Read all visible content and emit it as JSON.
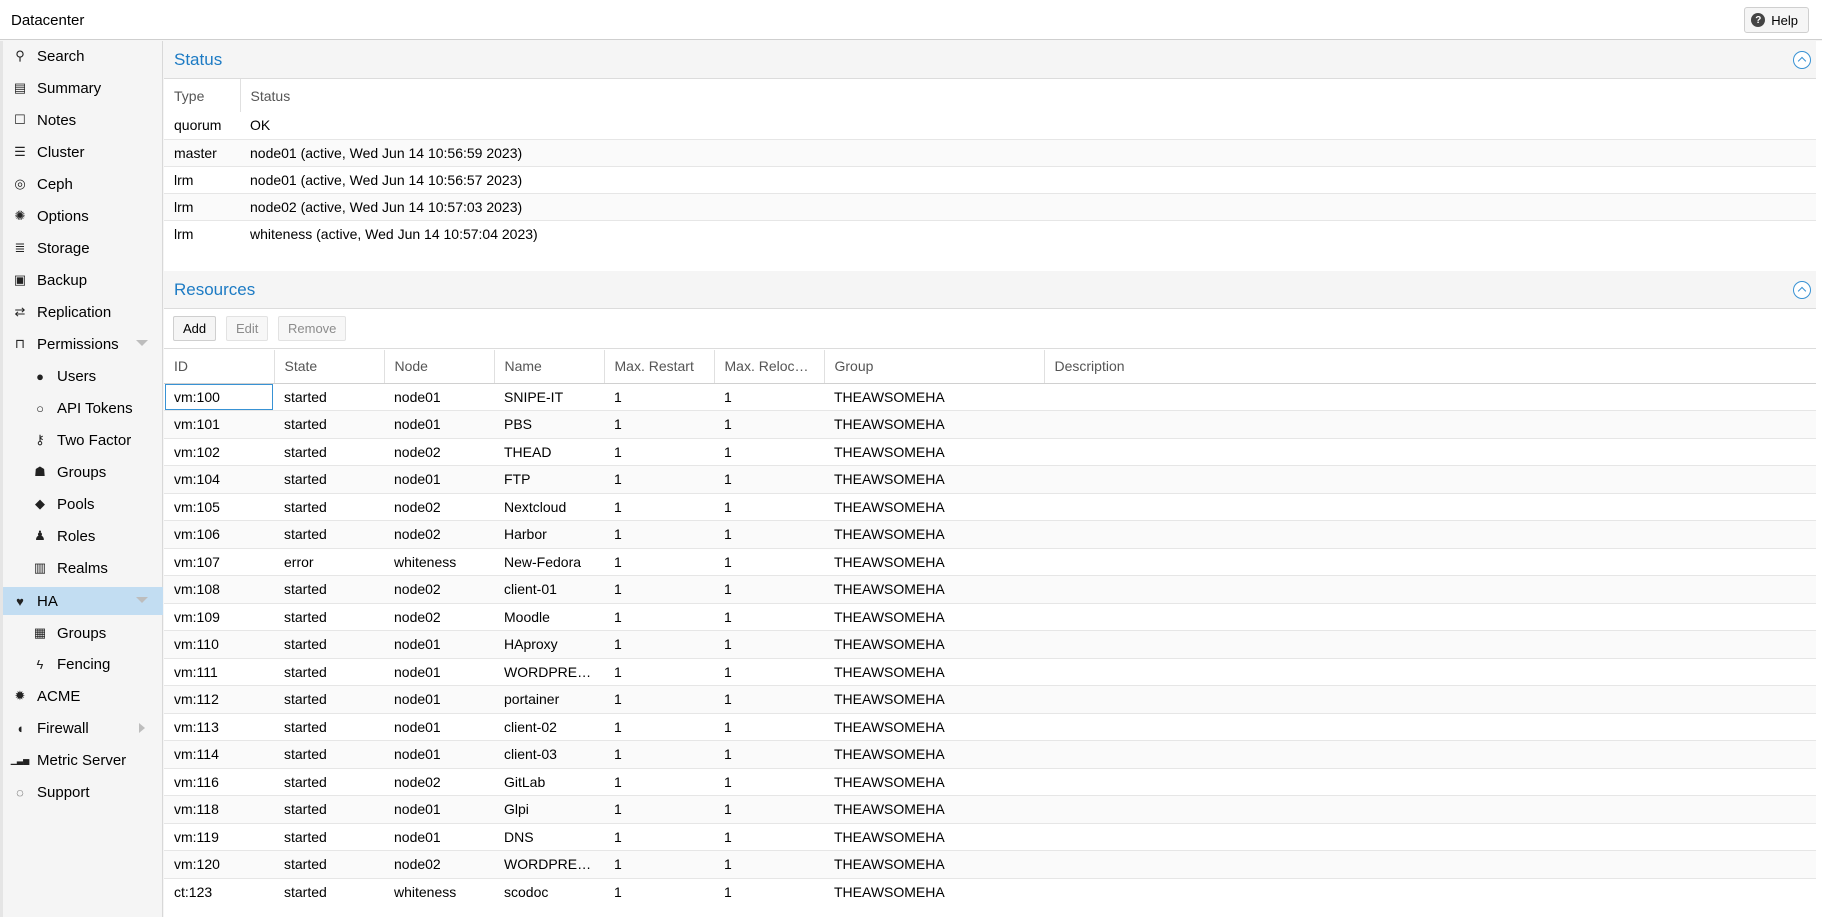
{
  "header": {
    "title": "Datacenter",
    "help_label": "Help"
  },
  "sidebar": {
    "items": [
      {
        "label": "Search",
        "icon": "search-icon",
        "glyph": "⚲",
        "sub": false
      },
      {
        "label": "Summary",
        "icon": "book-icon",
        "glyph": "▤",
        "sub": false
      },
      {
        "label": "Notes",
        "icon": "note-icon",
        "glyph": "☐",
        "sub": false
      },
      {
        "label": "Cluster",
        "icon": "server-icon",
        "glyph": "☰",
        "sub": false
      },
      {
        "label": "Ceph",
        "icon": "ceph-icon",
        "glyph": "◎",
        "sub": false
      },
      {
        "label": "Options",
        "icon": "gear-icon",
        "glyph": "✺",
        "sub": false
      },
      {
        "label": "Storage",
        "icon": "database-icon",
        "glyph": "≣",
        "sub": false
      },
      {
        "label": "Backup",
        "icon": "floppy-icon",
        "glyph": "▣",
        "sub": false
      },
      {
        "label": "Replication",
        "icon": "retweet-icon",
        "glyph": "⇄",
        "sub": false
      },
      {
        "label": "Permissions",
        "icon": "unlock-icon",
        "glyph": "⊓",
        "sub": false,
        "expander": "down"
      },
      {
        "label": "Users",
        "icon": "user-icon",
        "glyph": "●",
        "sub": true
      },
      {
        "label": "API Tokens",
        "icon": "user-outline-icon",
        "glyph": "○",
        "sub": true
      },
      {
        "label": "Two Factor",
        "icon": "key-icon",
        "glyph": "⚷",
        "sub": true
      },
      {
        "label": "Groups",
        "icon": "users-icon",
        "glyph": "☗",
        "sub": true
      },
      {
        "label": "Pools",
        "icon": "tags-icon",
        "glyph": "◆",
        "sub": true
      },
      {
        "label": "Roles",
        "icon": "male-icon",
        "glyph": "♟",
        "sub": true
      },
      {
        "label": "Realms",
        "icon": "address-book-icon",
        "glyph": "▥",
        "sub": true
      },
      {
        "label": "HA",
        "icon": "heartbeat-icon",
        "glyph": "♥",
        "sub": false,
        "expander": "down",
        "selected": true
      },
      {
        "label": "Groups",
        "icon": "object-group-icon",
        "glyph": "▦",
        "sub": true
      },
      {
        "label": "Fencing",
        "icon": "bolt-icon",
        "glyph": "ϟ",
        "sub": true
      },
      {
        "label": "ACME",
        "icon": "certificate-icon",
        "glyph": "✹",
        "sub": false
      },
      {
        "label": "Firewall",
        "icon": "shield-icon",
        "glyph": "◖",
        "sub": false,
        "expander": "right"
      },
      {
        "label": "Metric Server",
        "icon": "bar-chart-icon",
        "glyph": "▁▃▅",
        "sub": false
      },
      {
        "label": "Support",
        "icon": "comments-icon",
        "glyph": "◌",
        "sub": false
      }
    ]
  },
  "status": {
    "title": "Status",
    "columns": [
      "Type",
      "Status"
    ],
    "rows": [
      [
        "quorum",
        "OK"
      ],
      [
        "master",
        "node01 (active, Wed Jun 14 10:56:59 2023)"
      ],
      [
        "lrm",
        "node01 (active, Wed Jun 14 10:56:57 2023)"
      ],
      [
        "lrm",
        "node02 (active, Wed Jun 14 10:57:03 2023)"
      ],
      [
        "lrm",
        "whiteness (active, Wed Jun 14 10:57:04 2023)"
      ]
    ]
  },
  "resources": {
    "title": "Resources",
    "toolbar": {
      "add": "Add",
      "edit": "Edit",
      "remove": "Remove"
    },
    "columns": [
      "ID",
      "State",
      "Node",
      "Name",
      "Max. Restart",
      "Max. Relocate",
      "Group",
      "Description"
    ],
    "rows": [
      [
        "vm:100",
        "started",
        "node01",
        "SNIPE-IT",
        "1",
        "1",
        "THEAWSOMEHA",
        ""
      ],
      [
        "vm:101",
        "started",
        "node01",
        "PBS",
        "1",
        "1",
        "THEAWSOMEHA",
        ""
      ],
      [
        "vm:102",
        "started",
        "node02",
        "THEAD",
        "1",
        "1",
        "THEAWSOMEHA",
        ""
      ],
      [
        "vm:104",
        "started",
        "node01",
        "FTP",
        "1",
        "1",
        "THEAWSOMEHA",
        ""
      ],
      [
        "vm:105",
        "started",
        "node02",
        "Nextcloud",
        "1",
        "1",
        "THEAWSOMEHA",
        ""
      ],
      [
        "vm:106",
        "started",
        "node02",
        "Harbor",
        "1",
        "1",
        "THEAWSOMEHA",
        ""
      ],
      [
        "vm:107",
        "error",
        "whiteness",
        "New-Fedora",
        "1",
        "1",
        "THEAWSOMEHA",
        ""
      ],
      [
        "vm:108",
        "started",
        "node02",
        "client-01",
        "1",
        "1",
        "THEAWSOMEHA",
        ""
      ],
      [
        "vm:109",
        "started",
        "node02",
        "Moodle",
        "1",
        "1",
        "THEAWSOMEHA",
        ""
      ],
      [
        "vm:110",
        "started",
        "node01",
        "HAproxy",
        "1",
        "1",
        "THEAWSOMEHA",
        ""
      ],
      [
        "vm:111",
        "started",
        "node01",
        "WORDPRESS",
        "1",
        "1",
        "THEAWSOMEHA",
        ""
      ],
      [
        "vm:112",
        "started",
        "node01",
        "portainer",
        "1",
        "1",
        "THEAWSOMEHA",
        ""
      ],
      [
        "vm:113",
        "started",
        "node01",
        "client-02",
        "1",
        "1",
        "THEAWSOMEHA",
        ""
      ],
      [
        "vm:114",
        "started",
        "node01",
        "client-03",
        "1",
        "1",
        "THEAWSOMEHA",
        ""
      ],
      [
        "vm:116",
        "started",
        "node02",
        "GitLab",
        "1",
        "1",
        "THEAWSOMEHA",
        ""
      ],
      [
        "vm:118",
        "started",
        "node01",
        "Glpi",
        "1",
        "1",
        "THEAWSOMEHA",
        ""
      ],
      [
        "vm:119",
        "started",
        "node01",
        "DNS",
        "1",
        "1",
        "THEAWSOMEHA",
        ""
      ],
      [
        "vm:120",
        "started",
        "node02",
        "WORDPRESS",
        "1",
        "1",
        "THEAWSOMEHA",
        ""
      ],
      [
        "ct:123",
        "started",
        "whiteness",
        "scodoc",
        "1",
        "1",
        "THEAWSOMEHA",
        ""
      ]
    ]
  },
  "colors": {
    "accent": "#1d7bc4",
    "selection": "#c2ddf2"
  }
}
